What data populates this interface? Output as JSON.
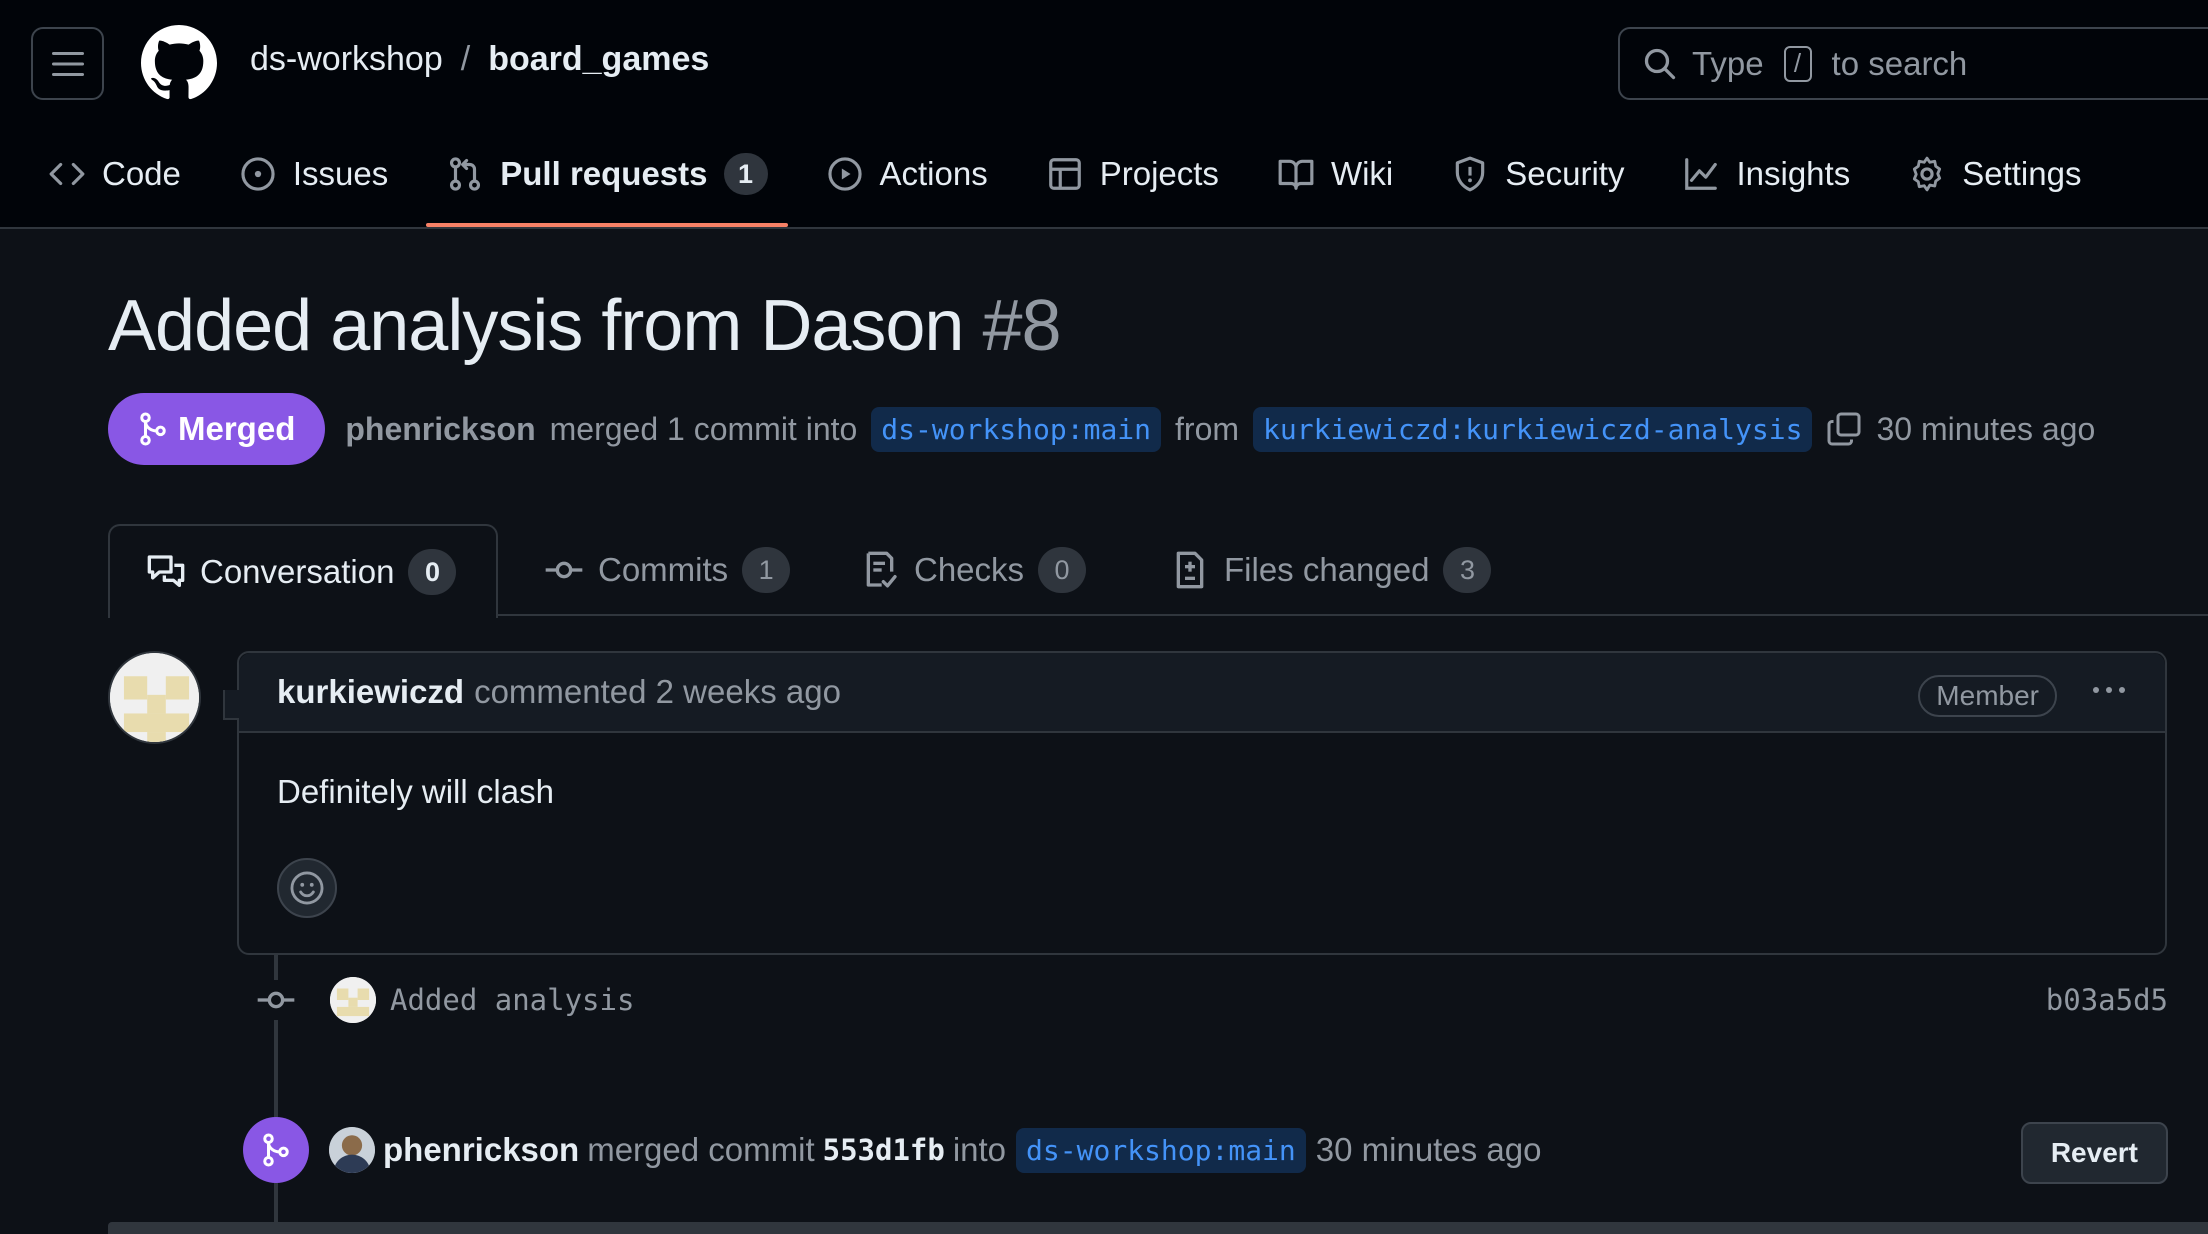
{
  "header": {
    "owner": "ds-workshop",
    "separator": "/",
    "repo": "board_games",
    "search": {
      "prefix": "Type",
      "key": "/",
      "suffix": "to search"
    }
  },
  "repo_nav": [
    {
      "label": "Code",
      "icon": "code-icon"
    },
    {
      "label": "Issues",
      "icon": "issue-icon"
    },
    {
      "label": "Pull requests",
      "icon": "pull-request-icon",
      "count": "1",
      "active": true
    },
    {
      "label": "Actions",
      "icon": "play-icon"
    },
    {
      "label": "Projects",
      "icon": "table-icon"
    },
    {
      "label": "Wiki",
      "icon": "book-icon"
    },
    {
      "label": "Security",
      "icon": "shield-icon"
    },
    {
      "label": "Insights",
      "icon": "graph-icon"
    },
    {
      "label": "Settings",
      "icon": "gear-icon"
    }
  ],
  "pr": {
    "title": "Added analysis from Dason",
    "number": "#8",
    "state": "Merged",
    "author": "phenrickson",
    "action_text": "merged 1 commit into",
    "base_branch": "ds-workshop:main",
    "from_text": "from",
    "head_branch": "kurkiewiczd:kurkiewiczd-analysis",
    "time": "30 minutes ago"
  },
  "tabs": [
    {
      "label": "Conversation",
      "count": "0",
      "icon": "comment-discussion-icon"
    },
    {
      "label": "Commits",
      "count": "1",
      "icon": "commit-icon"
    },
    {
      "label": "Checks",
      "count": "0",
      "icon": "checklist-icon"
    },
    {
      "label": "Files changed",
      "count": "3",
      "icon": "file-diff-icon"
    }
  ],
  "comment": {
    "user": "kurkiewiczd",
    "meta": "commented 2 weeks ago",
    "badge": "Member",
    "body": "Definitely will clash"
  },
  "commit": {
    "message": "Added analysis",
    "sha": "b03a5d5"
  },
  "merge_event": {
    "user": "phenrickson",
    "text1": "merged commit",
    "sha": "553d1fb",
    "text2": "into",
    "branch": "ds-workshop:main",
    "time": "30 minutes ago",
    "revert_label": "Revert"
  },
  "colors": {
    "background": "#0d1117",
    "header": "#010409",
    "merged_purple": "#8957e5",
    "link_blue": "#4493f8",
    "active_underline": "#f78166"
  }
}
